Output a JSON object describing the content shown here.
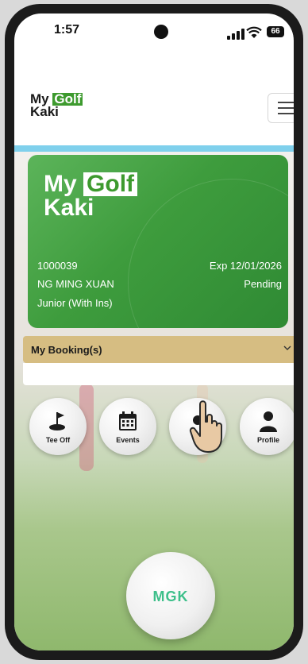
{
  "status": {
    "time": "1:57",
    "battery": "66"
  },
  "logo": {
    "my": "My",
    "golf": "Golf",
    "kaki": "Kaki"
  },
  "card": {
    "logo_my": "My",
    "logo_golf": "Golf",
    "logo_kaki": "Kaki",
    "member_id": "1000039",
    "expiry": "Exp 12/01/2026",
    "name": "NG MING XUAN",
    "status": "Pending",
    "membership_type": "Junior (With Ins)"
  },
  "booking": {
    "title": "My Booking(s)"
  },
  "shortcuts": {
    "tee_off": "Tee Off",
    "events": "Events",
    "profile": "Profile"
  },
  "ball": {
    "logo": "MGK"
  },
  "icons": {
    "menu": "hamburger-icon",
    "tee_off": "golf-flag-icon",
    "events": "calendar-icon",
    "profile": "person-icon",
    "pointer": "hand-pointer-icon"
  },
  "colors": {
    "brand_green": "#3d9a2e",
    "booking_bar": "#d6bd82",
    "accent_blue": "#7fd0ec"
  }
}
